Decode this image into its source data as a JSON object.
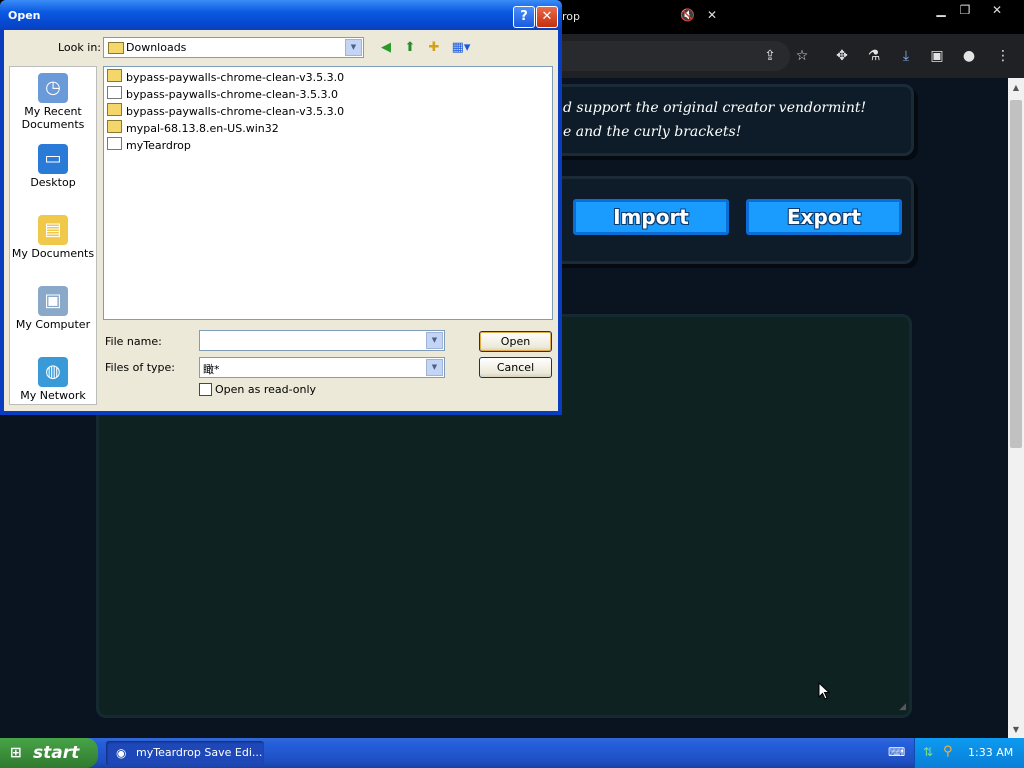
{
  "browser": {
    "tab_title": "myTeardrop",
    "tab_title_visible": "rop",
    "mute_glyph": "🔇",
    "close_tab_glyph": "✕",
    "window_controls": [
      "▁",
      "❐",
      "✕"
    ]
  },
  "page": {
    "notice_line1": "d support the original creator vendormint!",
    "notice_line2": "e and the curly brackets!",
    "import_label": "Import",
    "export_label": "Export"
  },
  "dialog": {
    "title": "Open",
    "help_glyph": "?",
    "close_glyph": "✕",
    "look_in_label": "Look in:",
    "look_in_value": "Downloads",
    "places": [
      {
        "label": "My Recent Documents",
        "icon": "recent-documents-icon"
      },
      {
        "label": "Desktop",
        "icon": "desktop-icon"
      },
      {
        "label": "My Documents",
        "icon": "my-documents-icon"
      },
      {
        "label": "My Computer",
        "icon": "my-computer-icon"
      },
      {
        "label": "My Network",
        "icon": "my-network-icon"
      }
    ],
    "files": [
      {
        "name": "bypass-paywalls-chrome-clean-v3.5.3.0",
        "icon": "folder-icon"
      },
      {
        "name": "bypass-paywalls-chrome-clean-3.5.3.0",
        "icon": "crx-file-icon"
      },
      {
        "name": "bypass-paywalls-chrome-clean-v3.5.3.0",
        "icon": "zip-icon"
      },
      {
        "name": "mypal-68.13.8.en-US.win32",
        "icon": "zip-icon"
      },
      {
        "name": "myTeardrop",
        "icon": "text-file-icon"
      }
    ],
    "file_name_label": "File name:",
    "file_name_value": "",
    "files_of_type_label": "Files of type:",
    "files_of_type_value": "瞰*",
    "read_only_label": "Open as read-only",
    "open_label": "Open",
    "cancel_label": "Cancel"
  },
  "taskbar": {
    "start_label": "start",
    "task_label": "myTeardrop Save Edi...",
    "clock": "1:33 AM"
  },
  "colors": {
    "page_bg": "#0a1420",
    "button_blue": "#1a9cff",
    "xp_title_blue": "#0a5ae0",
    "dialog_face": "#ece9d8"
  }
}
